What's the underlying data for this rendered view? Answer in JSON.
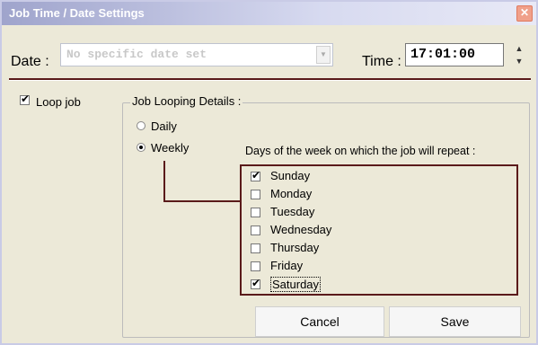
{
  "window": {
    "title": "Job Time / Date Settings",
    "close_glyph": "✕"
  },
  "date": {
    "label": "Date :",
    "value": "No specific date set"
  },
  "time": {
    "label": "Time :",
    "value": "17:01:00"
  },
  "loop_job": {
    "label": "Loop job",
    "checked": true
  },
  "looping": {
    "title": "Job Looping Details :",
    "daily_label": "Daily",
    "weekly_label": "Weekly",
    "selected": "weekly",
    "days_prompt": "Days of the week on which the job will repeat :",
    "days": [
      {
        "label": "Sunday",
        "checked": true
      },
      {
        "label": "Monday",
        "checked": false
      },
      {
        "label": "Tuesday",
        "checked": false
      },
      {
        "label": "Wednesday",
        "checked": false
      },
      {
        "label": "Thursday",
        "checked": false
      },
      {
        "label": "Friday",
        "checked": false
      },
      {
        "label": "Saturday",
        "checked": true
      }
    ]
  },
  "buttons": {
    "cancel": "Cancel",
    "save": "Save"
  },
  "colors": {
    "accent_border": "#5a1a1a",
    "dialog_bg": "#ece9d8",
    "close_button": "#f0a08a"
  }
}
